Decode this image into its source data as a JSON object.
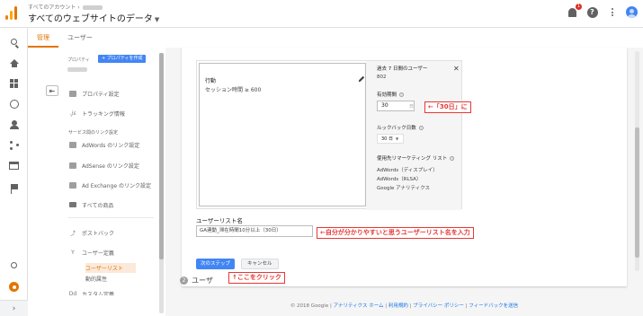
{
  "header": {
    "breadcrumb": "すべてのアカウント ›",
    "title": "すべてのウェブサイトのデータ",
    "notification_count": "1"
  },
  "rail": {
    "items": [
      "search-icon",
      "home-icon",
      "dashboard-icon",
      "realtime-icon",
      "audience-icon",
      "acquisition-icon",
      "behavior-icon",
      "conversions-icon",
      "discover-icon",
      "admin-icon",
      "expand-icon"
    ]
  },
  "tabs": [
    {
      "label": "管理"
    },
    {
      "label": "ユーザー"
    }
  ],
  "property_col": {
    "heading": "プロパティ",
    "create_button": "+ プロパティを作成",
    "items": [
      {
        "label": "プロパティ設定",
        "icon": "settings-square-icon"
      },
      {
        "label": "トラッキング情報",
        "icon": "js-icon"
      },
      {
        "label": "AdWords のリンク設定",
        "icon": "adwords-icon"
      },
      {
        "label": "AdSense のリンク設定",
        "icon": "adsense-icon"
      },
      {
        "label": "Ad Exchange のリンク設定",
        "icon": "adexchange-icon"
      },
      {
        "label": "すべての商品",
        "icon": "products-icon"
      },
      {
        "label": "ポストバック",
        "icon": "postback-icon"
      },
      {
        "label": "ユーザー定義",
        "icon": "audience-definition-icon"
      },
      {
        "label": "カスタム定義",
        "icon": "custom-definition-icon"
      }
    ],
    "section_label": "サービス間のリンク設定",
    "sub_items": [
      {
        "label": "ユーザーリスト",
        "active": true
      },
      {
        "label": "動的属性",
        "active": false
      }
    ]
  },
  "builder": {
    "condition_title": "行動",
    "condition_text": "セッション時間 ≥ 600",
    "stats": {
      "past7_label": "過去 7 日間のユーザー",
      "past7_value": "802",
      "duration_label": "有効期間",
      "duration_value": "30",
      "duration_unit": "日",
      "lookback_label": "ルックバック日数",
      "lookback_value": "30 日",
      "dest_label": "使用先リマーケティング リスト",
      "destinations": [
        "AdWords（ディスプレイ）",
        "AdWords（RLSA）",
        "Google アナリティクス"
      ]
    }
  },
  "form": {
    "name_label": "ユーザーリスト名",
    "name_value": "GA連動_滞在時間10分以上（30日）",
    "next_button": "次のステップ",
    "cancel_button": "キャンセル",
    "step2_label": "ユーザ",
    "step2_number": "2"
  },
  "annotations": {
    "duration_note": "←「30日」に",
    "name_note": "←自分が分かりやすいと思うユーザーリスト名を入力",
    "click_note": "↑ここをクリック"
  },
  "footer": {
    "copyright": "© 2018 Google",
    "links": [
      "アナリティクス ホーム",
      "利用規約",
      "プライバシー ポリシー",
      "フィードバックを送信"
    ]
  },
  "colors": {
    "accent": "#e37400",
    "primary_button": "#4285f4",
    "annotation": "#e53935"
  }
}
